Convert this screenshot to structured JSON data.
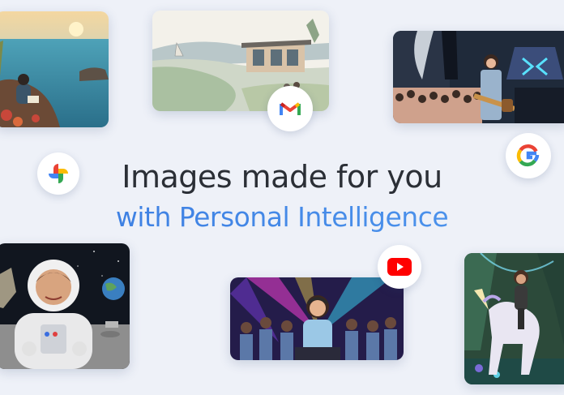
{
  "headline": {
    "line1": "Images made for you",
    "line2": "with Personal Intelligence"
  },
  "colors": {
    "background": "#eef1f8",
    "headline_dark": "#2b2f36",
    "headline_blue": "#3f86e8"
  },
  "cards": [
    {
      "name": "reading-on-rocks-illustration"
    },
    {
      "name": "watercolor-coastal-house"
    },
    {
      "name": "guitarist-concert-photo"
    },
    {
      "name": "astronaut-on-moon-illustration"
    },
    {
      "name": "dj-party-illustration"
    },
    {
      "name": "unicorn-rider-forest-illustration"
    }
  ],
  "icons": [
    "gmail-icon",
    "google-g-icon",
    "google-photos-icon",
    "youtube-icon"
  ]
}
